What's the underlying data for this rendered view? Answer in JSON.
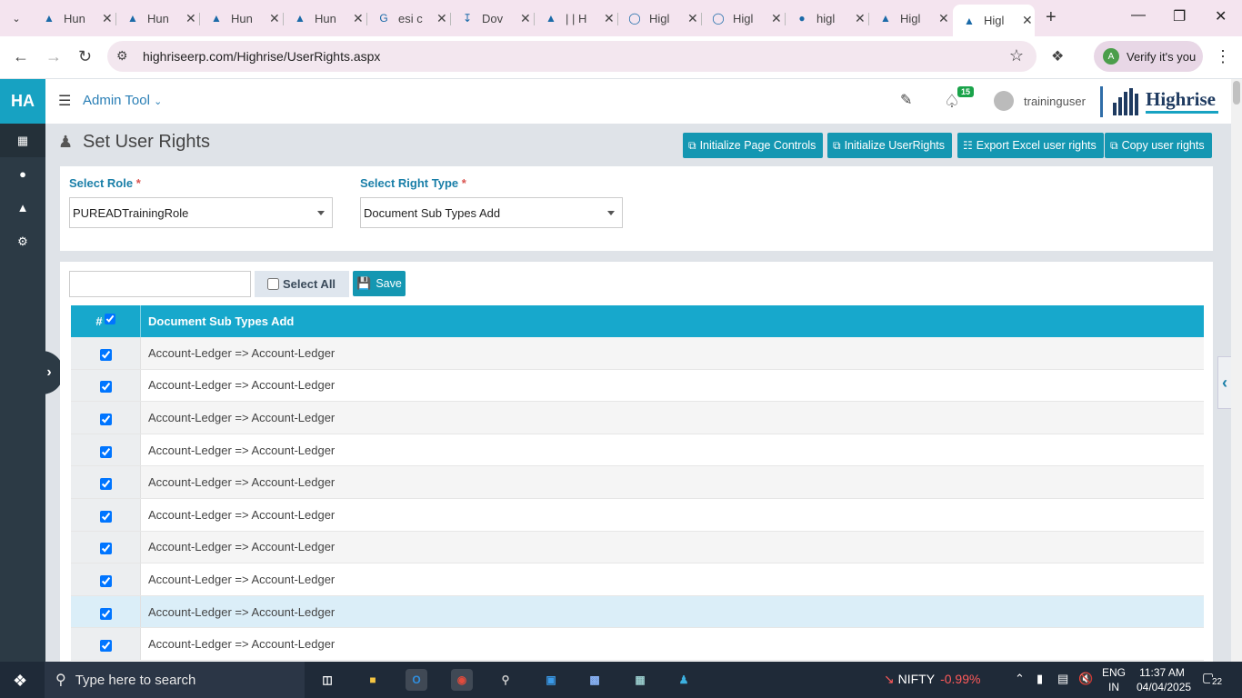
{
  "browser": {
    "tabs": [
      {
        "title": "Hun",
        "icon": "highrise-favicon"
      },
      {
        "title": "Hun",
        "icon": "highrise-favicon"
      },
      {
        "title": "Hun",
        "icon": "highrise-favicon"
      },
      {
        "title": "Hun",
        "icon": "highrise-favicon"
      },
      {
        "title": "esi c",
        "icon": "google-favicon"
      },
      {
        "title": "Dov",
        "icon": "download-icon"
      },
      {
        "title": "| | H",
        "icon": "highrise-favicon"
      },
      {
        "title": "Higl",
        "icon": "loading-favicon"
      },
      {
        "title": "Higl",
        "icon": "loading-favicon"
      },
      {
        "title": "higl",
        "icon": "globe-favicon"
      },
      {
        "title": "Higl",
        "icon": "highrise-favicon"
      },
      {
        "title": "Higl",
        "icon": "highrise-favicon",
        "active": true
      }
    ],
    "url": "highriseerp.com/Highrise/UserRights.aspx",
    "verify_label": "Verify it's you",
    "verify_avatar": "A"
  },
  "app": {
    "brand": "HA",
    "module": "Admin Tool",
    "notification_count": "15",
    "username": "traininguser",
    "logo_text": "Highrise",
    "sidebar_icons": [
      "document-icon",
      "user-icon",
      "warning-icon",
      "gear-icon"
    ]
  },
  "page": {
    "title": "Set User Rights",
    "buttons": {
      "init_page_controls": "Initialize Page Controls",
      "init_user_rights": "Initialize UserRights",
      "export_excel": "Export Excel user rights",
      "copy_user_rights": "Copy user rights"
    },
    "form": {
      "role_label": "Select Role",
      "role_value": "PUREADTrainingRole",
      "right_type_label": "Select Right Type",
      "right_type_value": "Document Sub Types Add",
      "required_mark": "*"
    },
    "grid_tools": {
      "filter_value": "",
      "select_all_label": "Select All",
      "save_label": "Save"
    },
    "grid": {
      "header_num": "#",
      "header_title": "Document Sub Types Add",
      "rows": [
        {
          "label": "Account-Ledger => Account-Ledger",
          "checked": true
        },
        {
          "label": "Account-Ledger => Account-Ledger",
          "checked": true
        },
        {
          "label": "Account-Ledger => Account-Ledger",
          "checked": true
        },
        {
          "label": "Account-Ledger => Account-Ledger",
          "checked": true
        },
        {
          "label": "Account-Ledger => Account-Ledger",
          "checked": true
        },
        {
          "label": "Account-Ledger => Account-Ledger",
          "checked": true
        },
        {
          "label": "Account-Ledger => Account-Ledger",
          "checked": true
        },
        {
          "label": "Account-Ledger => Account-Ledger",
          "checked": true
        },
        {
          "label": "Account-Ledger => Account-Ledger",
          "checked": true,
          "highlighted": true
        },
        {
          "label": "Account-Ledger => Account-Ledger",
          "checked": true
        }
      ]
    }
  },
  "taskbar": {
    "search_placeholder": "Type here to search",
    "nifty_label": "NIFTY",
    "nifty_change": "-0.99%",
    "lang_line1": "ENG",
    "lang_line2": "IN",
    "time": "11:37 AM",
    "date": "04/04/2025",
    "notification_count": "22"
  },
  "colors": {
    "accent": "#1497b2",
    "grid_header": "#17a8cc",
    "sidebar": "#2c3a45",
    "label": "#1a7fa8",
    "negative": "#ff5a5a"
  }
}
